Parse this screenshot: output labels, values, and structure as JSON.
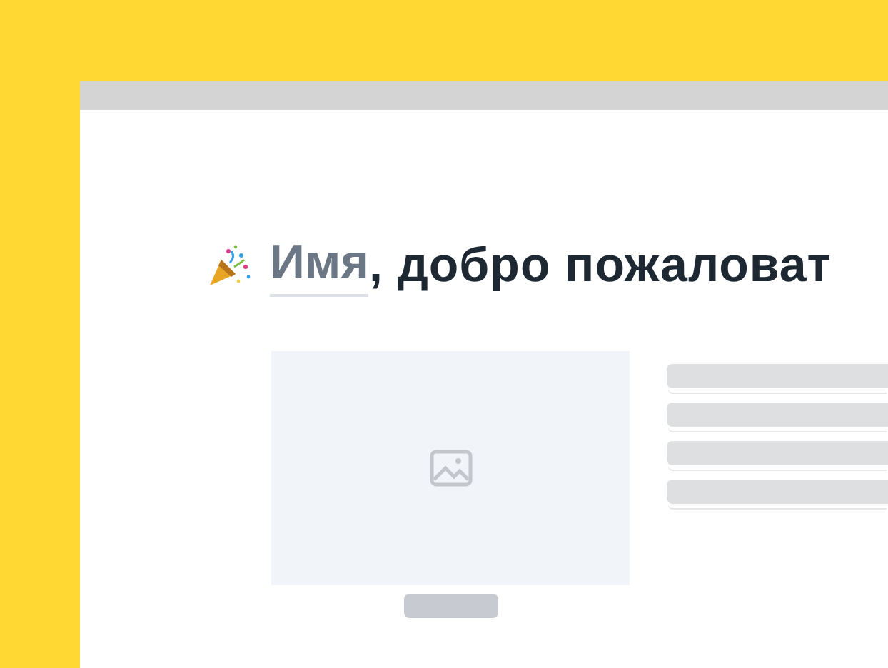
{
  "heading": {
    "name": "Имя",
    "text": ", добро пожаловат"
  }
}
